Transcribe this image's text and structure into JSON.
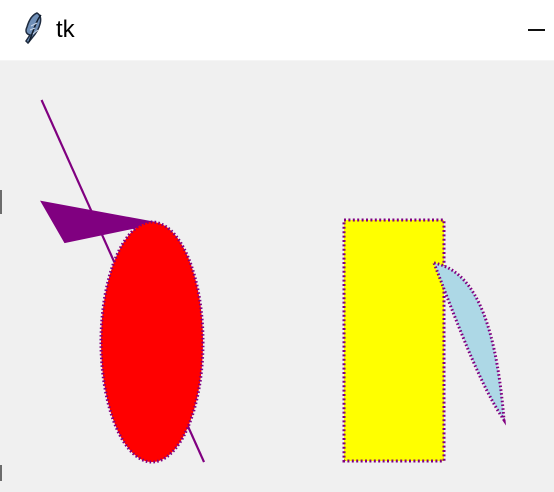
{
  "window": {
    "title": "tk",
    "icon": "feather-icon",
    "minimize_icon": "minimize-icon"
  },
  "canvas": {
    "background": "#f0f0f0",
    "shapes": [
      {
        "name": "dotted-diagonal-line",
        "type": "line",
        "outline": "#800080",
        "style": "dotted"
      },
      {
        "name": "purple-triangle",
        "type": "polygon",
        "fill": "#800080"
      },
      {
        "name": "red-ellipse",
        "type": "oval",
        "fill": "#ff0000",
        "outline": "#800080",
        "style": "dotted"
      },
      {
        "name": "yellow-rectangle",
        "type": "rectangle",
        "fill": "#ffff00",
        "outline": "#800080",
        "style": "dotted"
      },
      {
        "name": "light-blue-leaf",
        "type": "arc",
        "fill": "#add8e6",
        "outline": "#800080",
        "style": "dotted"
      }
    ]
  }
}
